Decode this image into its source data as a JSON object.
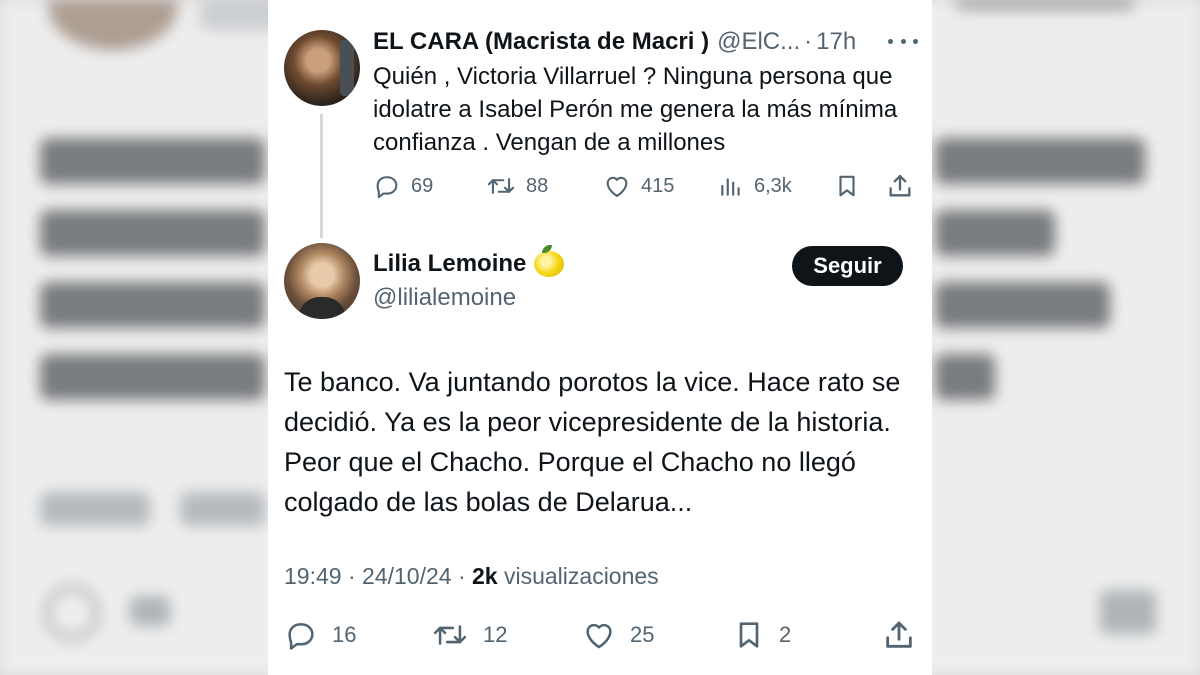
{
  "quoted_tweet": {
    "name": "EL CARA (Macrista de Macri )",
    "handle": "@ElC...",
    "separator": "·",
    "time": "17h",
    "text": "Quién , Victoria Villarruel ? Ninguna persona que idolatre a Isabel Perón me genera la más mínima confianza . Vengan de a millones",
    "replies": "69",
    "reposts": "88",
    "likes": "415",
    "views": "6,3k"
  },
  "main_tweet": {
    "name": "Lilia Lemoine",
    "handle": "@lilialemoine",
    "follow_label": "Seguir",
    "text": "Te banco. Va juntando porotos la vice. Hace rato se decidió. Ya es la peor vicepresidente de la historia. Peor que el Chacho. Porque el Chacho no llegó colgado de las bolas de Delarua...",
    "time": "19:49",
    "date": "24/10/24",
    "meta_separator": "·",
    "views_count": "2k",
    "views_label": "visualizaciones",
    "replies": "16",
    "reposts": "12",
    "likes": "25",
    "bookmarks": "2"
  },
  "colors": {
    "text_primary": "#0f1419",
    "text_secondary": "#536471",
    "thread_line": "#cfd9de",
    "button_bg": "#0f1419",
    "button_text": "#ffffff"
  },
  "icons": {
    "reply": "reply-icon",
    "repost": "repost-icon",
    "like": "heart-icon",
    "views": "views-icon",
    "bookmark": "bookmark-icon",
    "share": "share-icon",
    "more": "more-icon",
    "lemon": "lemon-icon"
  }
}
